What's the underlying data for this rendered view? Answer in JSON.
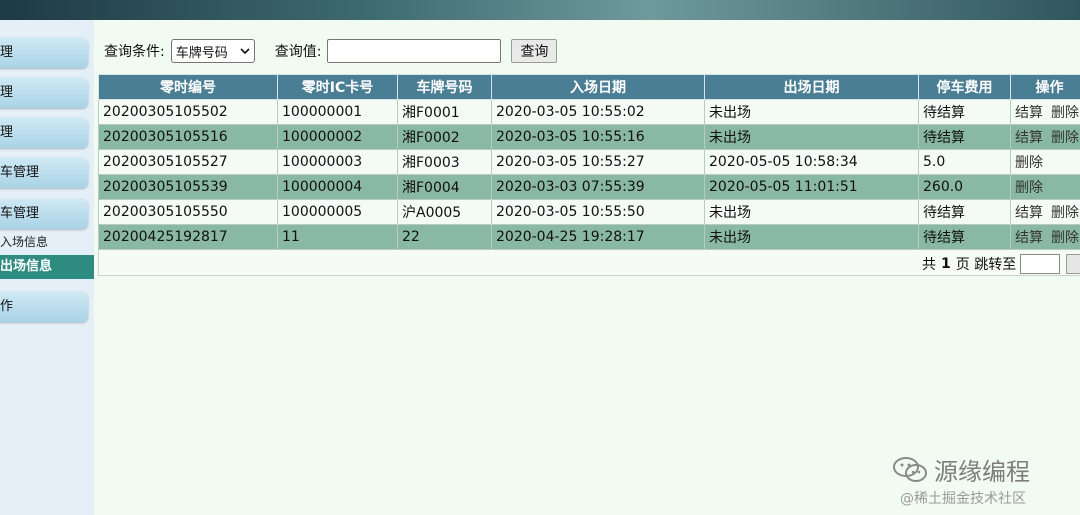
{
  "sidebar": {
    "buttons": [
      "理",
      "理",
      "理",
      "车管理",
      "车管理",
      "作"
    ],
    "subitems": [
      "入场信息",
      "出场信息"
    ]
  },
  "query": {
    "condition_label": "查询条件:",
    "condition_value": "车牌号码",
    "value_label": "查询值:",
    "value_input": "",
    "search_button": "查询"
  },
  "table": {
    "headers": [
      "零时编号",
      "零时IC卡号",
      "车牌号码",
      "入场日期",
      "出场日期",
      "停车费用",
      "操作"
    ],
    "rows": [
      [
        "20200305105502",
        "100000001",
        "湘F0001",
        "2020-03-05 10:55:02",
        "未出场",
        "待结算",
        "结算",
        "删除"
      ],
      [
        "20200305105516",
        "100000002",
        "湘F0002",
        "2020-03-05 10:55:16",
        "未出场",
        "待结算",
        "结算",
        "删除"
      ],
      [
        "20200305105527",
        "100000003",
        "湘F0003",
        "2020-03-05 10:55:27",
        "2020-05-05 10:58:34",
        "5.0",
        "",
        "删除"
      ],
      [
        "20200305105539",
        "100000004",
        "湘F0004",
        "2020-03-03 07:55:39",
        "2020-05-05 11:01:51",
        "260.0",
        "",
        "删除"
      ],
      [
        "20200305105550",
        "100000005",
        "沪A0005",
        "2020-03-05 10:55:50",
        "未出场",
        "待结算",
        "结算",
        "删除"
      ],
      [
        "20200425192817",
        "11",
        "22",
        "2020-04-25 19:28:17",
        "未出场",
        "待结算",
        "结算",
        "删除"
      ]
    ]
  },
  "pager": {
    "prefix": "共",
    "total_pages": "1",
    "suffix": "页 跳转至"
  },
  "watermark": {
    "title": "源缘编程",
    "site": "@稀土掘金技术社区"
  },
  "icons": {
    "dropdown": "chevron-down-icon",
    "watermark": "wechat-icon"
  }
}
